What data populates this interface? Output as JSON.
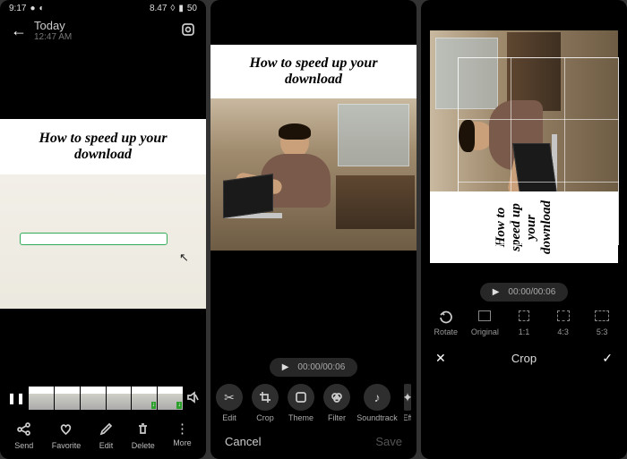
{
  "panel1": {
    "status": {
      "time": "9:17",
      "net": "8.47",
      "batt": "50"
    },
    "header": {
      "title": "Today",
      "subtitle": "12:47 AM"
    },
    "meme": {
      "line1": "How to speed up your",
      "line2": "download"
    },
    "bottom": {
      "send": "Send",
      "favorite": "Favorite",
      "edit": "Edit",
      "delete": "Delete",
      "more": "More"
    }
  },
  "panel2": {
    "meme": {
      "line1": "How to speed up your",
      "line2": "download"
    },
    "time": {
      "current": "00:00",
      "total": "00:06"
    },
    "tools": {
      "edit": "Edit",
      "crop": "Crop",
      "theme": "Theme",
      "filter": "Filter",
      "soundtrack": "Soundtrack",
      "effects": "Eff"
    },
    "cancel": "Cancel",
    "save": "Save"
  },
  "panel3": {
    "meme": {
      "line1": "How to speed up your",
      "line2": "download"
    },
    "time": {
      "current": "00:00",
      "total": "00:06"
    },
    "tools": {
      "rotate": "Rotate",
      "original": "Original",
      "r11": "1:1",
      "r43": "4:3",
      "r53": "5:3"
    },
    "title": "Crop"
  }
}
